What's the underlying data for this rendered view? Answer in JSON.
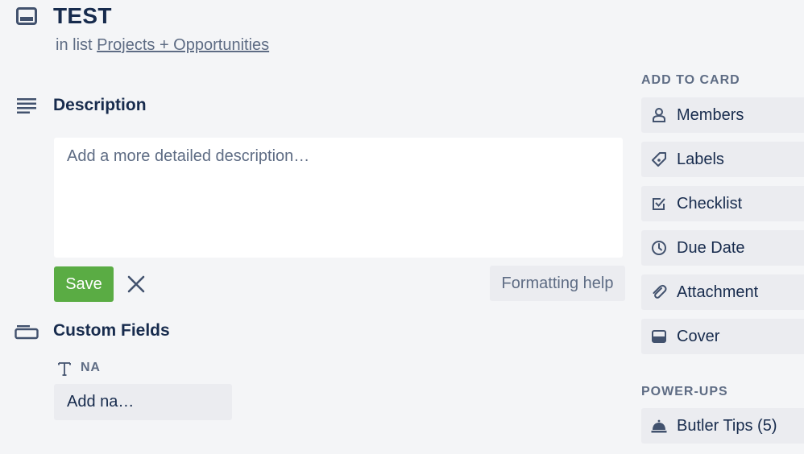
{
  "card": {
    "title": "TEST",
    "in_list_prefix": "in list",
    "list_name": "Projects + Opportunities"
  },
  "description": {
    "heading": "Description",
    "placeholder": "Add a more detailed description…",
    "save_label": "Save",
    "formatting_help_label": "Formatting help"
  },
  "custom_fields": {
    "heading": "Custom Fields",
    "field_label": "NA",
    "field_placeholder": "Add na…"
  },
  "sidebar": {
    "add_to_card_heading": "ADD TO CARD",
    "add_to_card": [
      {
        "label": "Members",
        "icon": "person-icon"
      },
      {
        "label": "Labels",
        "icon": "tag-icon"
      },
      {
        "label": "Checklist",
        "icon": "checkbox-icon"
      },
      {
        "label": "Due Date",
        "icon": "clock-icon"
      },
      {
        "label": "Attachment",
        "icon": "paperclip-icon"
      },
      {
        "label": "Cover",
        "icon": "cover-icon"
      }
    ],
    "power_ups_heading": "POWER-UPS",
    "power_ups": [
      {
        "label": "Butler Tips (5)",
        "icon": "butler-bell-icon"
      }
    ]
  },
  "colors": {
    "background": "#f4f5f7",
    "text": "#172b4d",
    "subtle_text": "#5e6c84",
    "button_bg": "#ebecf0",
    "save_green": "#5aac44"
  }
}
